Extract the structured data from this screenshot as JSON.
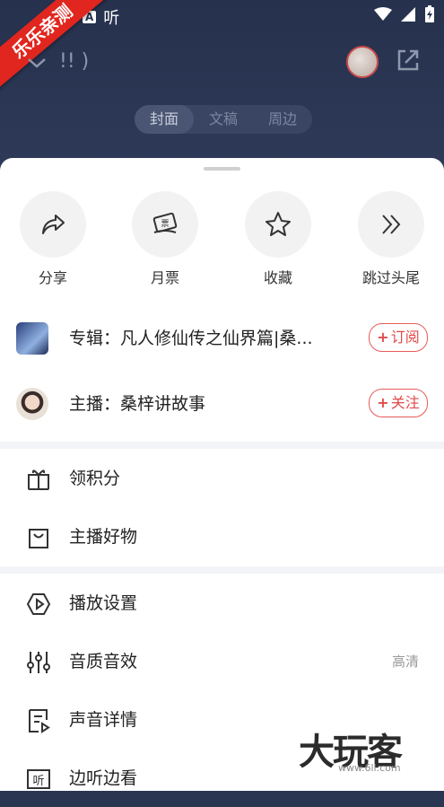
{
  "status": {
    "left_icons": [
      "A",
      "听"
    ]
  },
  "ribbon": {
    "text": "乐乐亲测"
  },
  "header": {
    "title": "!! )"
  },
  "tabs": [
    {
      "label": "封面",
      "active": true
    },
    {
      "label": "文稿",
      "active": false
    },
    {
      "label": "周边",
      "active": false
    }
  ],
  "actions": [
    {
      "label": "分享",
      "icon": "share-icon"
    },
    {
      "label": "月票",
      "icon": "ticket-icon"
    },
    {
      "label": "收藏",
      "icon": "star-icon"
    },
    {
      "label": "跳过头尾",
      "icon": "double-chevron-icon"
    }
  ],
  "album": {
    "text": "专辑：凡人修仙传之仙界篇|桑...",
    "button": "订阅"
  },
  "anchor": {
    "text": "主播：桑梓讲故事",
    "button": "关注"
  },
  "menu_group1": [
    {
      "label": "领积分",
      "icon": "gift-icon"
    },
    {
      "label": "主播好物",
      "icon": "shopping-bag-icon"
    }
  ],
  "menu_group2": [
    {
      "label": "播放设置",
      "icon": "play-settings-icon",
      "value": ""
    },
    {
      "label": "音质音效",
      "icon": "equalizer-icon",
      "value": "高清"
    },
    {
      "label": "声音详情",
      "icon": "document-play-icon",
      "value": ""
    },
    {
      "label": "边听边看",
      "icon": "listen-read-icon",
      "value": ""
    }
  ],
  "watermark": {
    "big": "大玩客",
    "small": "www.6ll.com"
  },
  "colors": {
    "accent": "#e24a4a",
    "header_bg": "#26314d"
  }
}
